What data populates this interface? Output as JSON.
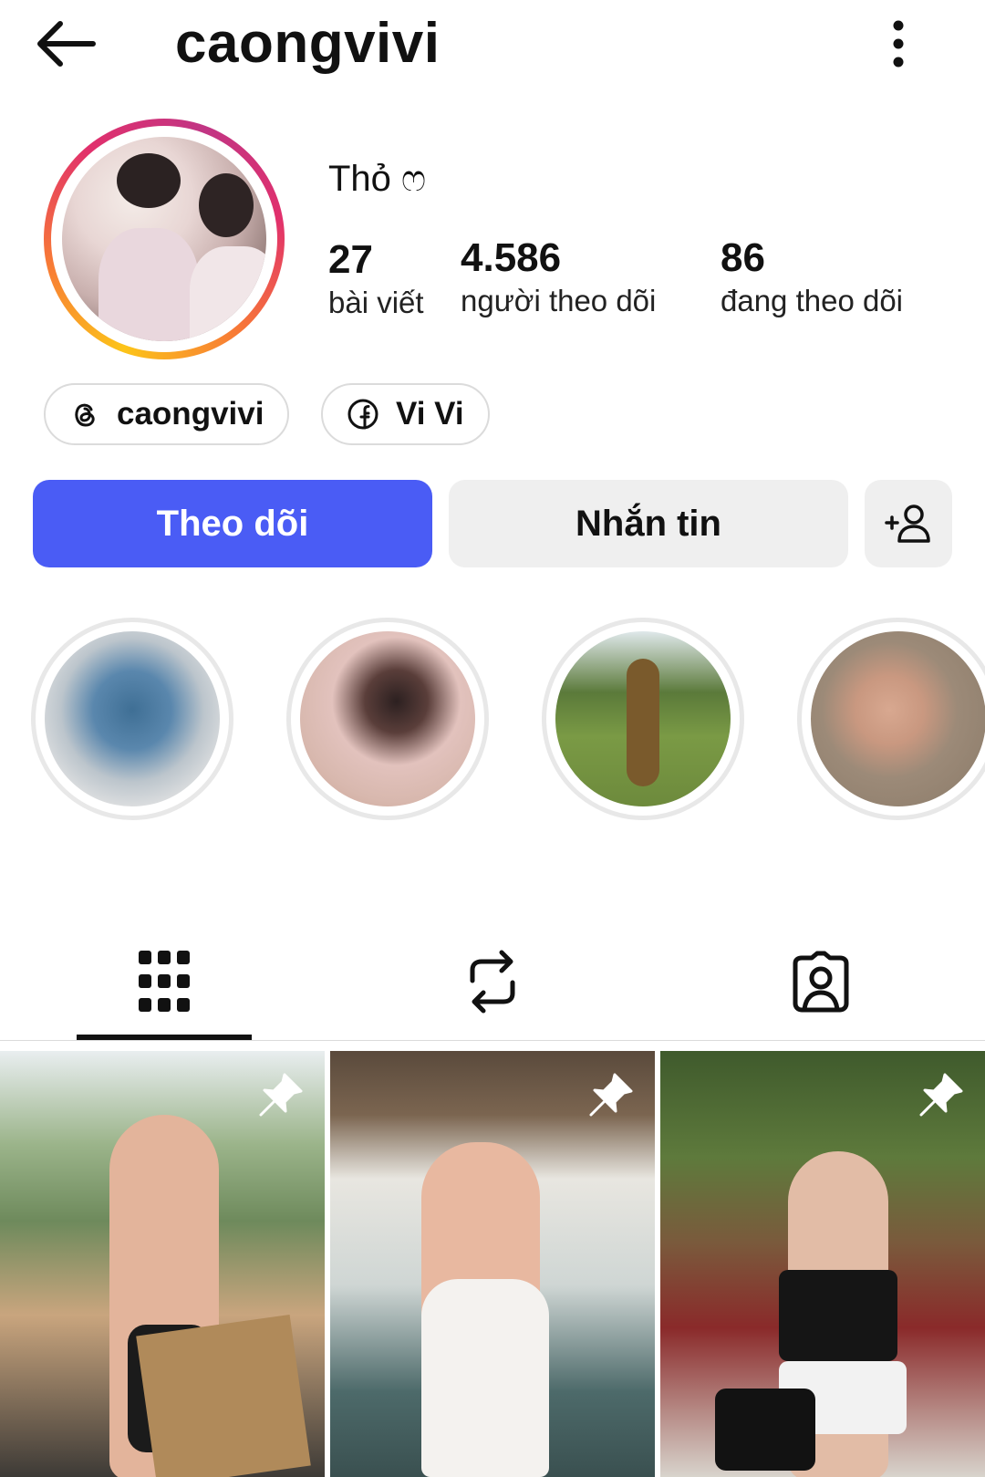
{
  "header": {
    "username": "caongvivi",
    "back_icon": "arrow-left-icon",
    "more_icon": "more-vertical-icon"
  },
  "profile": {
    "display_name": "Thỏ ෆ",
    "ring_colors": [
      "#fcc419",
      "#f77737",
      "#e1306c",
      "#c13584"
    ],
    "stats": [
      {
        "value": "27",
        "label": "bài viết"
      },
      {
        "value": "4.586",
        "label": "người theo dõi"
      },
      {
        "value": "86",
        "label": "đang theo dõi"
      }
    ],
    "links": [
      {
        "icon": "threads-icon",
        "label": "caongvivi"
      },
      {
        "icon": "facebook-icon",
        "label": "Vi Vi"
      }
    ]
  },
  "actions": {
    "follow_label": "Theo dõi",
    "message_label": "Nhắn tin",
    "add_user_icon": "add-user-icon",
    "follow_color": "#4a5cf5"
  },
  "tabs": [
    {
      "icon": "grid-icon",
      "active": true
    },
    {
      "icon": "reposts-icon",
      "active": false
    },
    {
      "icon": "tagged-icon",
      "active": false
    }
  ],
  "posts": [
    {
      "pinned": true
    },
    {
      "pinned": true
    },
    {
      "pinned": true
    }
  ]
}
